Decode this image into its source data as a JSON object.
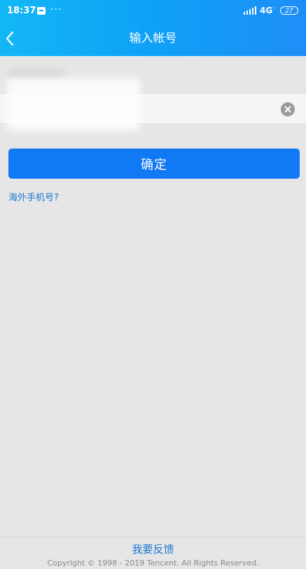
{
  "status_bar": {
    "time": "18:37",
    "more": "···",
    "network": "4G",
    "battery": "27"
  },
  "header": {
    "title": "输入帐号"
  },
  "form": {
    "account_value": "",
    "confirm_label": "确定",
    "overseas_link": "海外手机号?"
  },
  "footer": {
    "feedback_label": "我要反馈",
    "copyright": "Copyright © 1998 - 2019 Tencent. All Rights Reserved."
  },
  "colors": {
    "header_gradient_start": "#12b7f5",
    "header_gradient_end": "#1e8ef6",
    "primary_button": "#1079f3",
    "link": "#1a76d2",
    "page_background": "#e6e6e6"
  },
  "icons": {
    "back": "chevron-left-icon",
    "clear": "clear-circle-icon",
    "notification": "notification-icon",
    "signal": "signal-icon",
    "battery": "battery-icon"
  }
}
